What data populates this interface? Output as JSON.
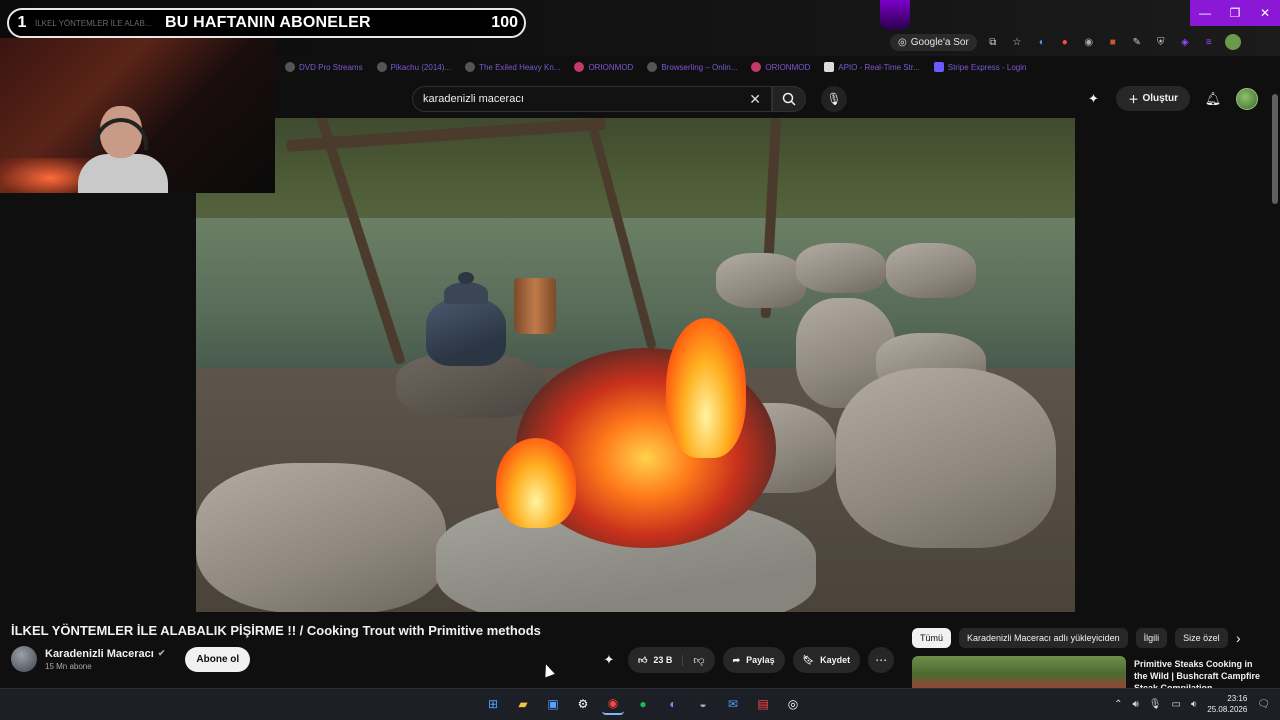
{
  "subscriber_banner": {
    "rank": "1",
    "ticker_text": "İLKEL YÖNTEMLER İLE ALAB...",
    "title": "BU HAFTANIN ABONELER",
    "count": "100"
  },
  "browser": {
    "google_sor_label": "Google'a Sor",
    "window_controls": [
      "—",
      "❐",
      "✕"
    ],
    "bookmarks": [
      {
        "label": "DVD Pro Streams",
        "icon": "gear-icon"
      },
      {
        "label": "Pikachu (2014)...",
        "icon": "triangle-icon"
      },
      {
        "label": "The Exiled Heavy Kn...",
        "icon": "triangle-icon"
      },
      {
        "label": "ORIONMOD",
        "icon": "circle-icon"
      },
      {
        "label": "Browserling – Onlin...",
        "icon": "gear-icon"
      },
      {
        "label": "ORIONMOD",
        "icon": "circle-icon"
      },
      {
        "label": "APIO - Real-Time Str...",
        "icon": "square-icon"
      },
      {
        "label": "Stripe Express - Login",
        "icon": "square-icon"
      }
    ]
  },
  "youtube": {
    "search_value": "karadenizli maceracı",
    "create_label": "Oluştur"
  },
  "video": {
    "title": "İLKEL YÖNTEMLER İLE ALABALIK PİŞİRME !! / Cooking Trout with Primitive methods",
    "channel_name": "Karadenizli Maceracı",
    "channel_subs": "15 Mn abone",
    "subscribe_label": "Abone ol",
    "like_count": "23 B",
    "share_label": "Paylaş",
    "save_label": "Kaydet"
  },
  "sidebar": {
    "chips": [
      "Tümü",
      "Karadenizli Maceracı adlı yükleyiciden",
      "İlgili",
      "Size özel"
    ],
    "recommended": [
      {
        "title": "Primitive Steaks Cooking in the Wild | Bushcraft Campfire Steak Compilation"
      }
    ]
  },
  "taskbar": {
    "time": "23:16",
    "date": "25.08.2026"
  }
}
